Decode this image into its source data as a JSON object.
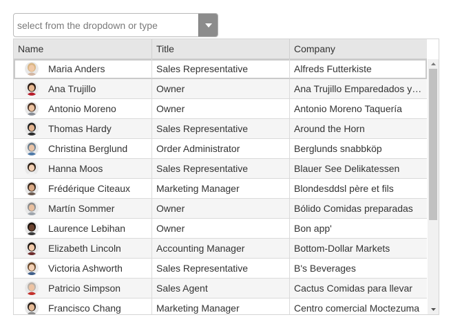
{
  "combo": {
    "placeholder": "select from the dropdown or type",
    "button_icon": "caret-down-icon"
  },
  "grid": {
    "columns": [
      "Name",
      "Title",
      "Company"
    ],
    "scroll_position": 0,
    "rows": [
      {
        "name": "Maria Anders",
        "title": "Sales Representative",
        "company": "Alfreds Futterkiste",
        "selected": true,
        "avatar": {
          "skin": "#f0c9a6",
          "hair": "#d8b584",
          "shirt": "#d2b7a4"
        }
      },
      {
        "name": "Ana Trujillo",
        "title": "Owner",
        "company": "Ana Trujillo Emparedados y helados",
        "avatar": {
          "skin": "#e7b892",
          "hair": "#2a1a12",
          "shirt": "#b81c2a"
        }
      },
      {
        "name": "Antonio Moreno",
        "title": "Owner",
        "company": "Antonio Moreno Taquería",
        "avatar": {
          "skin": "#ecc2a0",
          "hair": "#4a3325",
          "shirt": "#8a8f97"
        }
      },
      {
        "name": "Thomas Hardy",
        "title": "Sales Representative",
        "company": "Around the Horn",
        "avatar": {
          "skin": "#e2b38f",
          "hair": "#1e1e1e",
          "shirt": "#2b2b2b"
        }
      },
      {
        "name": "Christina Berglund",
        "title": "Order Administrator",
        "company": "Berglunds snabbköp",
        "avatar": {
          "skin": "#e9c3a6",
          "hair": "#6b7d8c",
          "shirt": "#4f7aa8"
        }
      },
      {
        "name": "Hanna Moos",
        "title": "Sales Representative",
        "company": "Blauer See Delikatessen",
        "avatar": {
          "skin": "#f0cdb1",
          "hair": "#2d2016",
          "shirt": "#f2f2f2"
        }
      },
      {
        "name": "Frédérique Citeaux",
        "title": "Marketing Manager",
        "company": "Blondesddsl père et fils",
        "avatar": {
          "skin": "#d9a985",
          "hair": "#3a2a1e",
          "shirt": "#6a5a50"
        }
      },
      {
        "name": "Martín Sommer",
        "title": "Owner",
        "company": "Bólido Comidas preparadas",
        "avatar": {
          "skin": "#e8bf9f",
          "hair": "#8c8c8c",
          "shirt": "#9ea4ab"
        }
      },
      {
        "name": "Laurence Lebihan",
        "title": "Owner",
        "company": "Bon app'",
        "avatar": {
          "skin": "#6b4330",
          "hair": "#1a120d",
          "shirt": "#3a3a3a"
        }
      },
      {
        "name": "Elizabeth Lincoln",
        "title": "Accounting Manager",
        "company": "Bottom-Dollar Markets",
        "avatar": {
          "skin": "#f0c8a8",
          "hair": "#1f1712",
          "shirt": "#6d2b2b"
        }
      },
      {
        "name": "Victoria Ashworth",
        "title": "Sales Representative",
        "company": "B's Beverages",
        "avatar": {
          "skin": "#f2cfb3",
          "hair": "#6a4a2e",
          "shirt": "#3f5f8a"
        }
      },
      {
        "name": "Patricio Simpson",
        "title": "Sales Agent",
        "company": "Cactus Comidas para llevar",
        "avatar": {
          "skin": "#ecc3a3",
          "hair": "#b8b0a8",
          "shirt": "#c4302b"
        }
      },
      {
        "name": "Francisco Chang",
        "title": "Marketing Manager",
        "company": "Centro comercial Moctezuma",
        "avatar": {
          "skin": "#e4b995",
          "hair": "#2a201a",
          "shirt": "#8d8d8d"
        }
      }
    ]
  }
}
